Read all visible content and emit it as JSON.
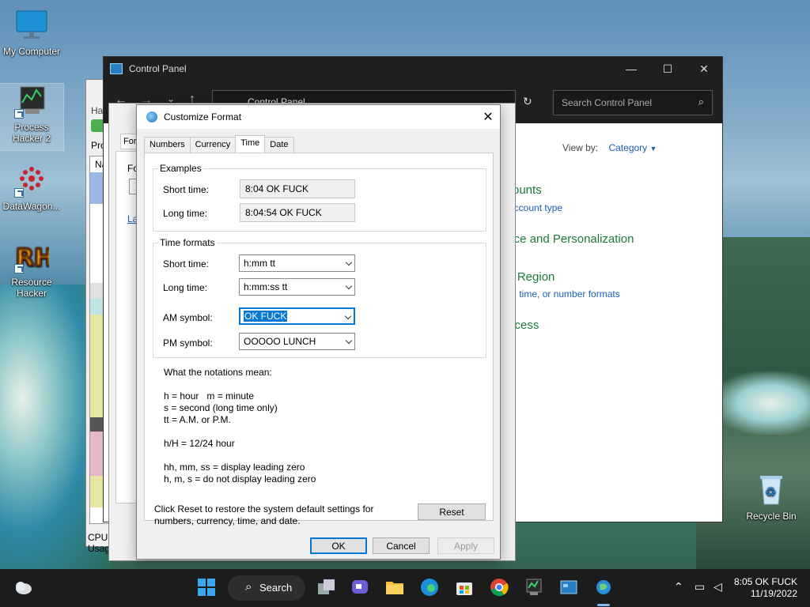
{
  "desktop": {
    "icons": [
      {
        "label": "My Computer"
      },
      {
        "label": "Process Hacker 2"
      },
      {
        "label": "DataWagon..."
      },
      {
        "label": "Resource Hacker"
      },
      {
        "label": "Recycle Bin"
      }
    ]
  },
  "control_panel": {
    "title": "Control Panel",
    "address": "Control Panel",
    "search_placeholder": "Search Control Panel",
    "view_by_label": "View by:",
    "view_by_value": "Category",
    "categories": [
      {
        "title": "ccounts",
        "sub": "e account type"
      },
      {
        "title": "ance and Personalization",
        "sub": ""
      },
      {
        "title": "nd Region",
        "sub": "ate, time, or number formats"
      },
      {
        "title": "Access",
        "sub": ""
      }
    ]
  },
  "background_windows": {
    "region_tab": "Form",
    "region_fo": "Fo",
    "region_en": "Er",
    "region_la": "La",
    "proc_ha": "Ha",
    "proc_pro": "Pro",
    "proc_na": "Na",
    "cpu_usage": "CPU Usage:"
  },
  "dialog": {
    "title": "Customize Format",
    "tabs": [
      "Numbers",
      "Currency",
      "Time",
      "Date"
    ],
    "examples": {
      "group_label": "Examples",
      "short_label": "Short time:",
      "short_value": "8:04 OK FUCK",
      "long_label": "Long time:",
      "long_value": "8:04:54 OK FUCK"
    },
    "formats": {
      "group_label": "Time formats",
      "short_label": "Short time:",
      "short_value": "h:mm tt",
      "long_label": "Long time:",
      "long_value": "h:mm:ss tt",
      "am_label": "AM symbol:",
      "am_value": "OK FUCK",
      "pm_label": "PM symbol:",
      "pm_value": "OOOOO LUNCH"
    },
    "notes": {
      "heading": "What the notations mean:",
      "l1": "h = hour   m = minute",
      "l2": "s = second (long time only)",
      "l3": "tt = A.M. or P.M.",
      "l4": "h/H = 12/24 hour",
      "l5": "hh, mm, ss = display leading zero",
      "l6": "h, m, s = do not display leading zero"
    },
    "reset_text_1": "Click Reset to restore the system default settings for",
    "reset_text_2": "numbers, currency, time, and date.",
    "reset_label": "Reset",
    "ok_label": "OK",
    "cancel_label": "Cancel",
    "apply_label": "Apply"
  },
  "taskbar": {
    "search_label": "Search",
    "time": "8:05 OK FUCK",
    "date": "11/19/2022"
  },
  "colors": {
    "accent": "#0078d4",
    "cp_green": "#1b7a3a",
    "cp_link": "#1a5fb4"
  }
}
